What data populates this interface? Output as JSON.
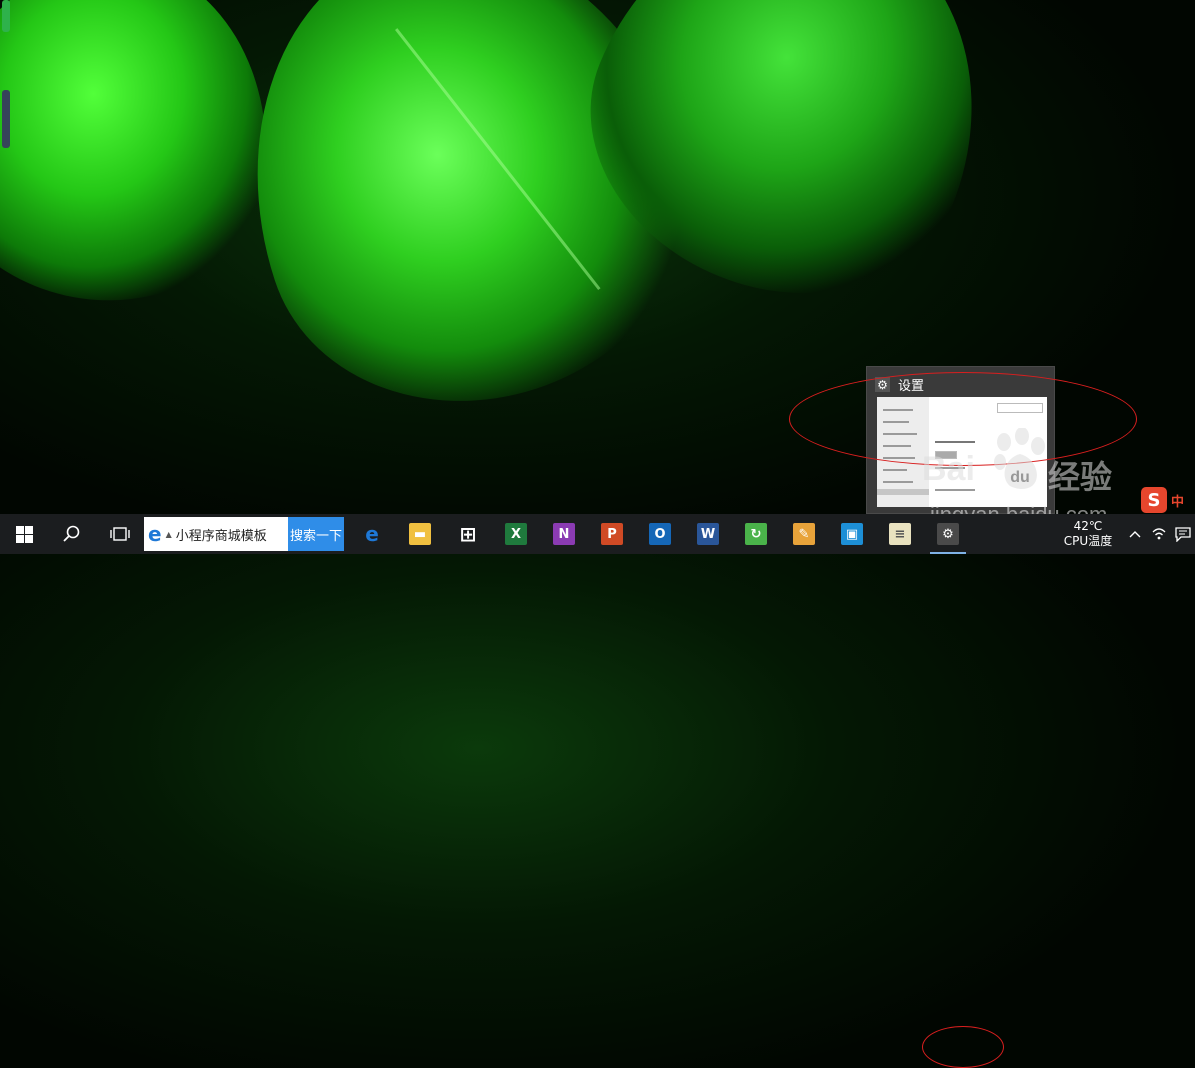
{
  "preview": {
    "title": "设置"
  },
  "watermark": {
    "logo_text": "Bai",
    "logo_text_tail": "du",
    "exp_text": "经验",
    "url": "jingyan.baidu.com"
  },
  "ime": {
    "s_label": "S",
    "lang": "中"
  },
  "taskbar": {
    "search_placeholder": "小程序商城模板",
    "search_button": "搜索一下",
    "apps": [
      {
        "name": "edge",
        "glyph": "e",
        "color": "#1e78d6"
      },
      {
        "name": "file-explorer",
        "glyph": "▬",
        "color": "#f0c040"
      },
      {
        "name": "store",
        "glyph": "⊞",
        "color": "#ffffff"
      },
      {
        "name": "excel",
        "glyph": "X",
        "color": "#1f7a3d"
      },
      {
        "name": "onenote",
        "glyph": "N",
        "color": "#8b3bb3"
      },
      {
        "name": "powerpoint",
        "glyph": "P",
        "color": "#d04a25"
      },
      {
        "name": "outlook",
        "glyph": "O",
        "color": "#1567b7"
      },
      {
        "name": "word",
        "glyph": "W",
        "color": "#2a5699"
      },
      {
        "name": "refresh-app",
        "glyph": "↻",
        "color": "#4ab34a"
      },
      {
        "name": "paint",
        "glyph": "✎",
        "color": "#e8a33a"
      },
      {
        "name": "virtualbox",
        "glyph": "▣",
        "color": "#1d8fd6"
      },
      {
        "name": "notes",
        "glyph": "≡",
        "color": "#e9e2bf"
      },
      {
        "name": "settings",
        "glyph": "⚙",
        "color": "#4a4a4a"
      }
    ]
  },
  "tray": {
    "temp_value": "42℃",
    "temp_label": "CPU温度",
    "chevron": "︿",
    "network": "📶",
    "notification": "💬"
  }
}
